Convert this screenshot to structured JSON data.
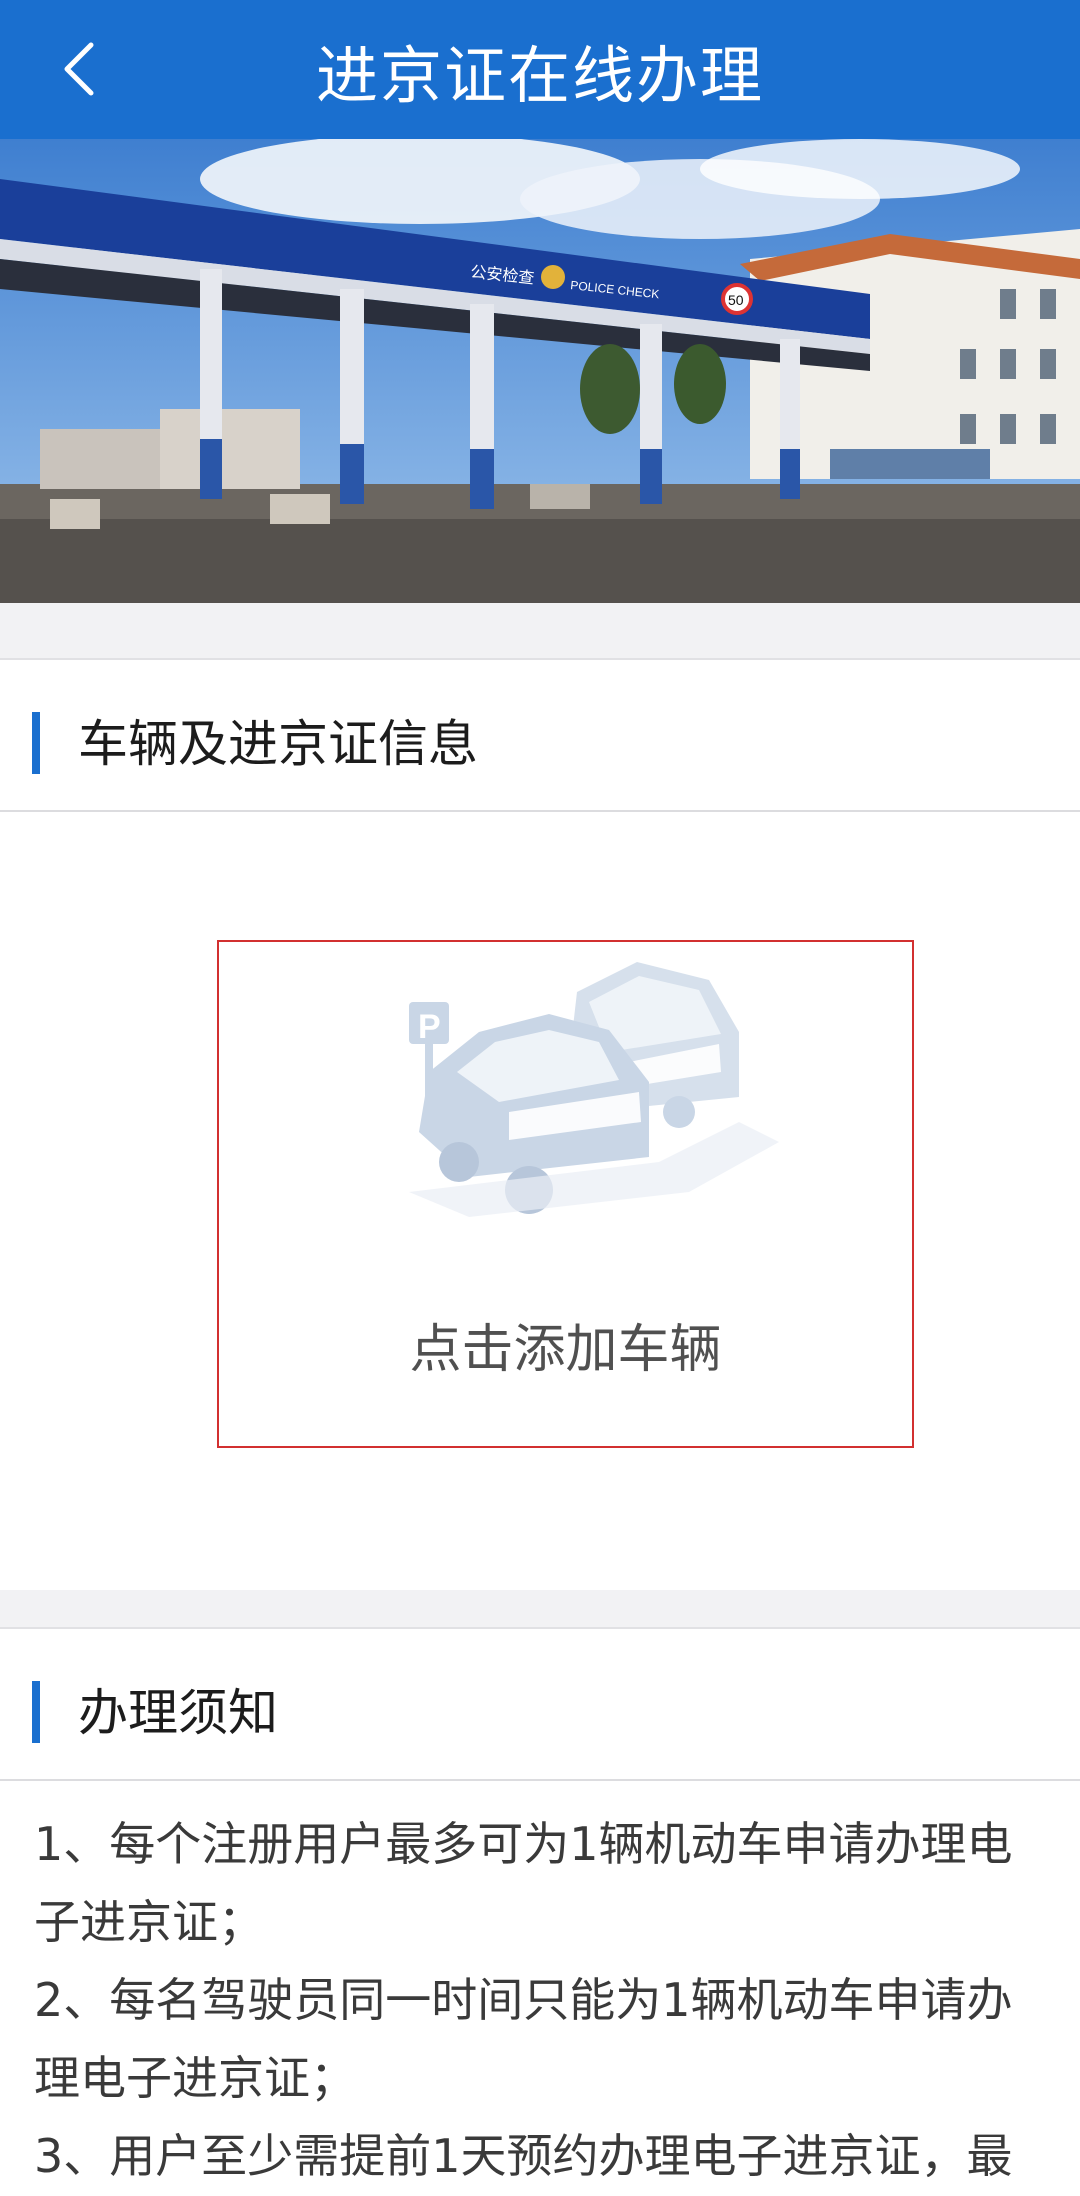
{
  "header": {
    "title": "进京证在线办理",
    "back_icon": "chevron-left-icon"
  },
  "banner": {
    "sign_text": "公安检查",
    "sign_text_en": "POLICE CHECK",
    "speed_limit": "50"
  },
  "vehicle_section": {
    "title": "车辆及进京证信息",
    "add_vehicle_label": "点击添加车辆",
    "illustration_icon": "parking-cars-icon",
    "parking_letter": "P"
  },
  "notice_section": {
    "title": "办理须知",
    "items": [
      "1、每个注册用户最多可为1辆机动车申请办理电子进京证；",
      "2、每名驾驶员同一时间只能为1辆机动车申请办理电子进京证；",
      "3、用户至少需提前1天预约办理电子进京证，最"
    ]
  },
  "colors": {
    "brand_blue": "#1a6fcf",
    "highlight_red": "#d23030"
  }
}
